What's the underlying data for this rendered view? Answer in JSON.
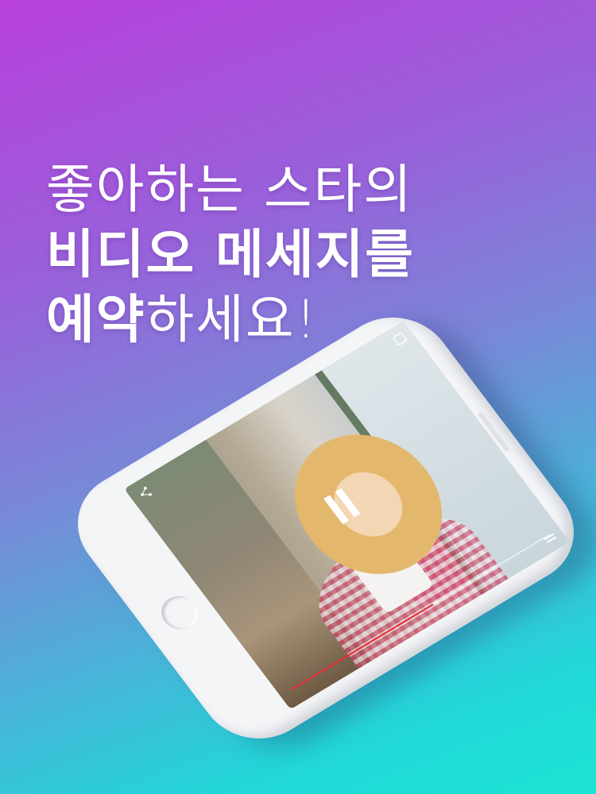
{
  "headline": {
    "line1": "좋아하는 스타의",
    "line2": "비디오 메세지를",
    "line3_bold": "예약",
    "line3_light": "하세요!"
  },
  "video": {
    "progress": 0.55,
    "state": "paused"
  },
  "colors": {
    "gradient_top": "#b840dc",
    "gradient_bottom": "#1de5d5",
    "progress": "#e8232e",
    "phone": "#f4f5f7"
  },
  "icons": [
    "share-icon",
    "pause-icon",
    "fullscreen-icon",
    "menu-icon"
  ]
}
